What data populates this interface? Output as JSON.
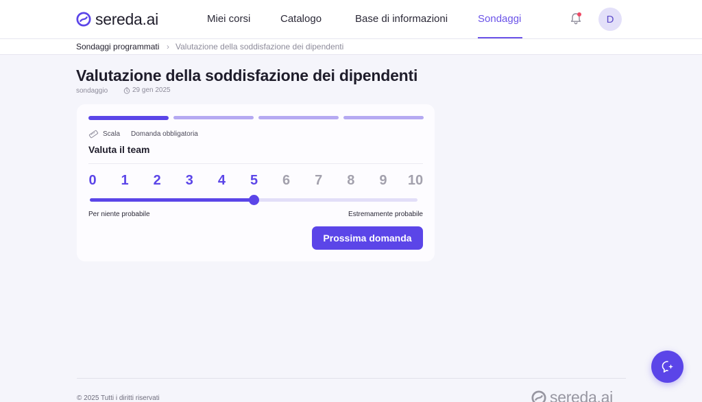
{
  "header": {
    "brand": "sereda.ai",
    "nav": [
      "Miei corsi",
      "Catalogo",
      "Base di informazioni",
      "Sondaggi"
    ],
    "active_nav": "Sondaggi",
    "avatar_initial": "D",
    "has_notification": true
  },
  "breadcrumb": {
    "parent": "Sondaggi programmati",
    "current": "Valutazione della soddisfazione dei dipendenti"
  },
  "survey": {
    "title": "Valutazione della soddisfazione dei dipendenti",
    "type": "sondaggio",
    "date": "29 gen 2025",
    "steps_total": 4,
    "current_step": 1
  },
  "question": {
    "kind": "Scala",
    "required_label": "Domanda obbligatoria",
    "text": "Valuta il team",
    "scale": [
      "0",
      "1",
      "2",
      "3",
      "4",
      "5",
      "6",
      "7",
      "8",
      "9",
      "10"
    ],
    "selected": 5,
    "min_label": "Per niente probabile",
    "max_label": "Estremamente probabile",
    "next_button": "Prossima domanda"
  },
  "footer": {
    "copyright": "© 2025 Tutti i diritti riservati",
    "brand": "sereda.ai"
  },
  "colors": {
    "accent": "#5b45e8",
    "nav_active": "#6a52e8",
    "inactive_step": "#b5a9f2",
    "notification": "#ef4a65"
  },
  "icons": [
    "sereda-logo-icon",
    "bell-icon",
    "clock-icon",
    "ruler-icon",
    "ai-assistant-icon"
  ]
}
